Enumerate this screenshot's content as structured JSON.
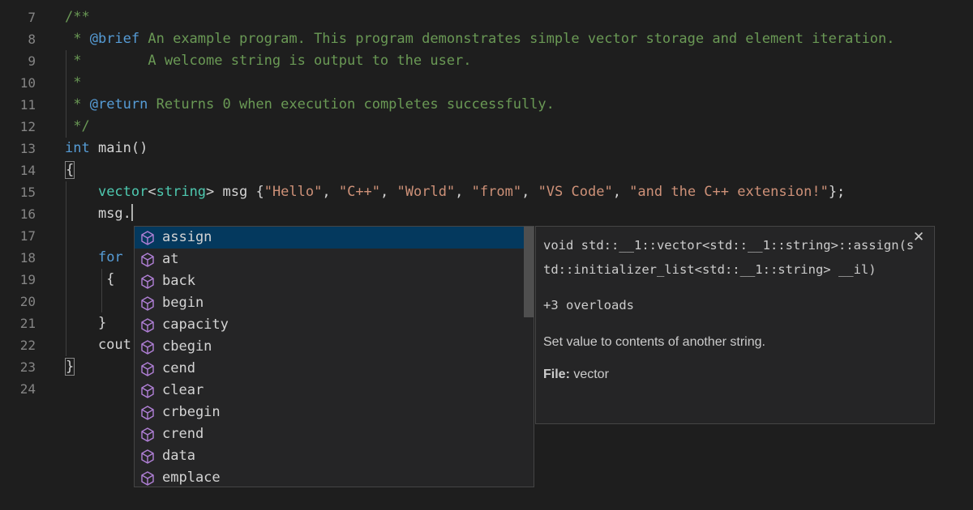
{
  "editor": {
    "line_numbers": [
      "7",
      "8",
      "9",
      "10",
      "11",
      "12",
      "13",
      "14",
      "15",
      "16",
      "17",
      "18",
      "19",
      "20",
      "21",
      "22",
      "23",
      "24"
    ],
    "lines": {
      "l7": "/**",
      "l8_star": " * ",
      "l8_tag": "@brief",
      "l8_text": " An example program. This program demonstrates simple vector storage and element iteration.",
      "l9": " *        A welcome string is output to the user.",
      "l10": " *",
      "l11_star": " * ",
      "l11_tag": "@return",
      "l11_text": " Returns 0 when execution completes successfully.",
      "l12": " */",
      "l13_kw": "int",
      "l13_fn": " main",
      "l13_rest": "()",
      "l14": "{",
      "l15_indent": "    ",
      "l15_ty1": "vector",
      "l15_lt": "<",
      "l15_ty2": "string",
      "l15_gt": "> msg {",
      "l15_s1": "\"Hello\"",
      "l15_s2": "\"C++\"",
      "l15_s3": "\"World\"",
      "l15_s4": "\"from\"",
      "l15_s5": "\"VS Code\"",
      "l15_s6": "\"and the C++ extension!\"",
      "l15_end": "};",
      "l16": "    msg.",
      "l18_kw": "for",
      "l19": "     {",
      "l21": "    }",
      "l22": "    cout",
      "l23": "}"
    }
  },
  "suggest": {
    "items": [
      {
        "label": "assign"
      },
      {
        "label": "at"
      },
      {
        "label": "back"
      },
      {
        "label": "begin"
      },
      {
        "label": "capacity"
      },
      {
        "label": "cbegin"
      },
      {
        "label": "cend"
      },
      {
        "label": "clear"
      },
      {
        "label": "crbegin"
      },
      {
        "label": "crend"
      },
      {
        "label": "data"
      },
      {
        "label": "emplace"
      }
    ],
    "selected_index": 0,
    "icon": "method-cube-icon",
    "icon_color": "#b180d7"
  },
  "details": {
    "signature": "void std::__1::vector<std::__1::string>::assign(std::initializer_list<std::__1::string> __il)",
    "overloads": "+3 overloads",
    "doc": "Set value to contents of another string.",
    "file_label": "File:",
    "file_value": " vector",
    "close_icon": "close-icon"
  },
  "colors": {
    "background": "#1e1e1e",
    "comment": "#6a9955",
    "keyword": "#569cd6",
    "type": "#4ec9b0",
    "string": "#ce9178",
    "selection": "#04395e"
  }
}
